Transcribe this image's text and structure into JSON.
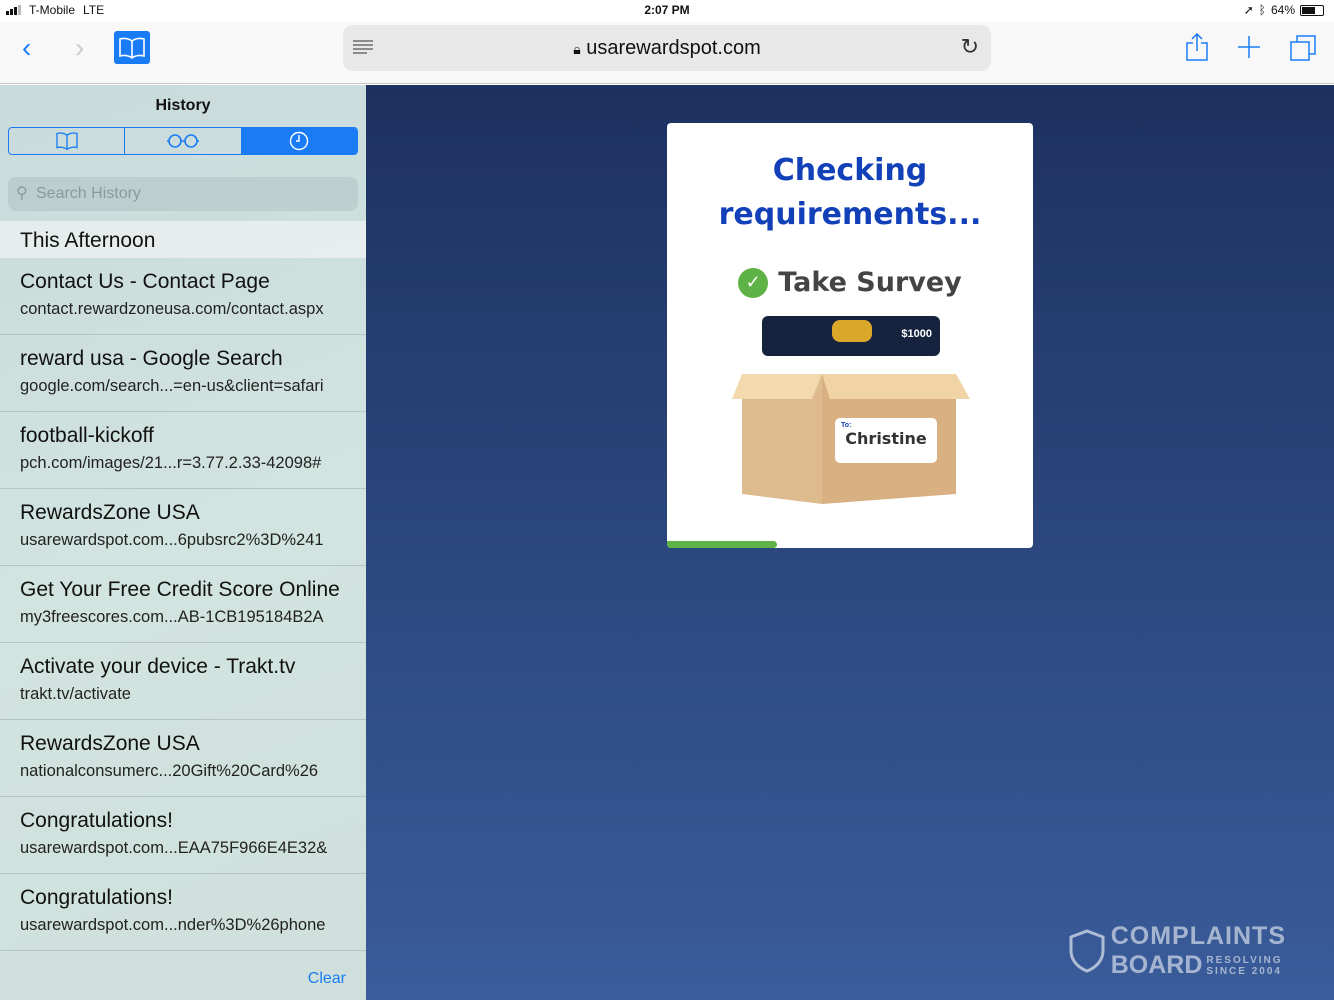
{
  "status": {
    "carrier": "T-Mobile",
    "network": "LTE",
    "time": "2:07 PM",
    "battery": "64%",
    "battery_level": 0.64
  },
  "toolbar": {
    "url": "usarewardspot.com"
  },
  "sidebar": {
    "title": "History",
    "search_placeholder": "Search History",
    "section": "This Afternoon",
    "clear": "Clear",
    "items": [
      {
        "title": "Contact Us - Contact Page",
        "url": "contact.rewardzoneusa.com/contact.aspx"
      },
      {
        "title": "reward usa - Google Search",
        "url": "google.com/search...=en-us&client=safari"
      },
      {
        "title": "football-kickoff",
        "url": "pch.com/images/21...r=3.77.2.33-42098#"
      },
      {
        "title": "RewardsZone USA",
        "url": "usarewardspot.com...6pubsrc2%3D%241"
      },
      {
        "title": "Get Your Free Credit Score Online",
        "url": "my3freescores.com...AB-1CB195184B2A"
      },
      {
        "title": "Activate your device - Trakt.tv",
        "url": "trakt.tv/activate"
      },
      {
        "title": "RewardsZone USA",
        "url": "nationalconsumerc...20Gift%20Card%26"
      },
      {
        "title": "Congratulations!",
        "url": "usarewardspot.com...EAA75F966E4E32&"
      },
      {
        "title": "Congratulations!",
        "url": "usarewardspot.com...nder%3D%26phone"
      }
    ]
  },
  "card": {
    "heading_line1": "Checking",
    "heading_line2": "requirements...",
    "step": "Take Survey",
    "gift_amount": "$1000",
    "label_to": "To:",
    "recipient": "Christine",
    "progress": 0.3
  },
  "watermark": {
    "line1": "COMPLAINTS",
    "line2": "BOARD",
    "tag1": "RESOLVING",
    "tag2": "SINCE 2004"
  }
}
